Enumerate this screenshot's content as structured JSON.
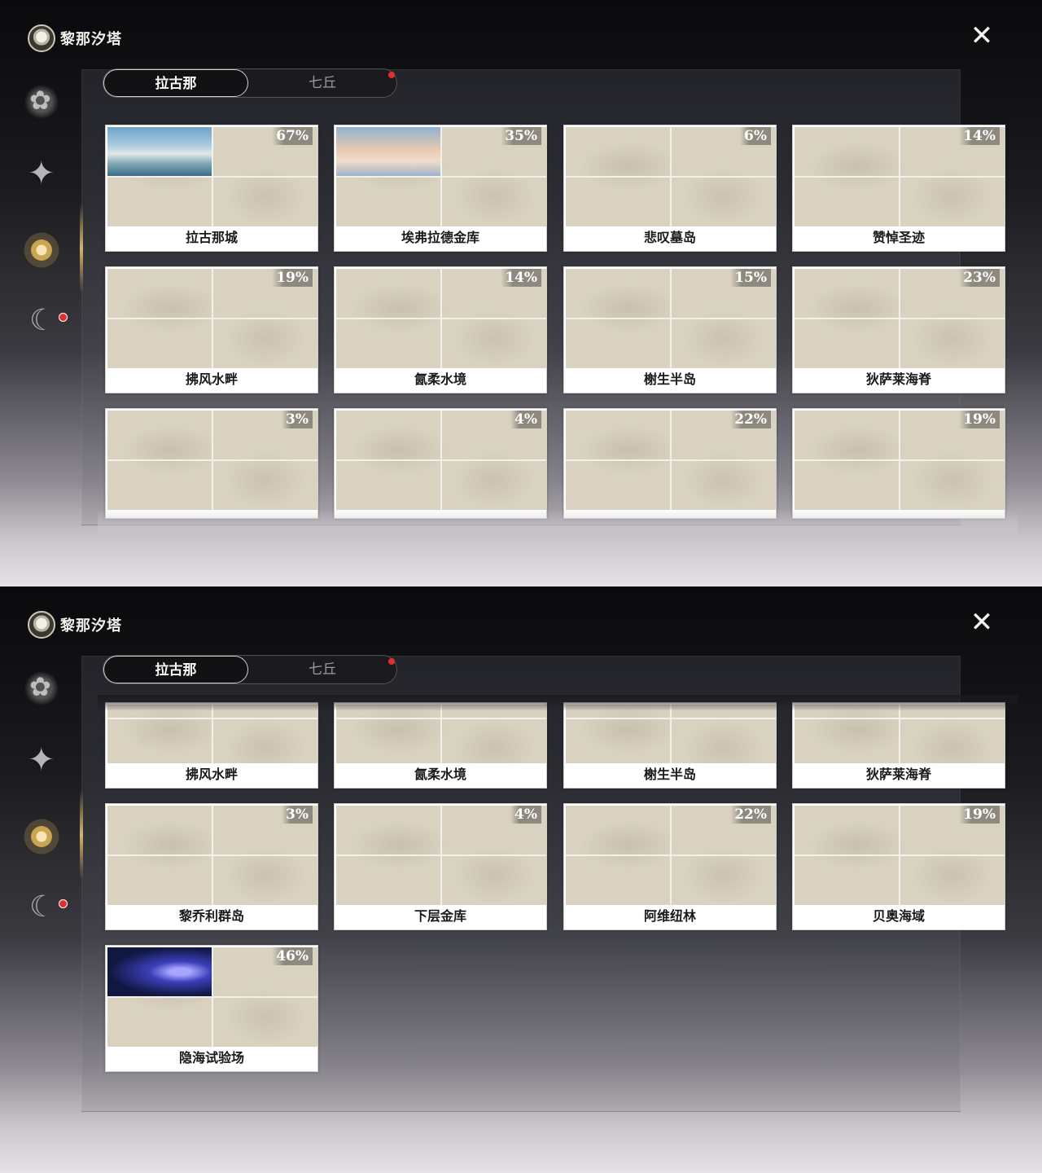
{
  "app": {
    "title": "黎那汐塔"
  },
  "tabs": {
    "active": "拉古那",
    "other": "七丘"
  },
  "icons": {
    "close": "close-x-icon"
  },
  "colors": {
    "badge": "#e0302d",
    "accent_gold": "#c9a653"
  },
  "panel1": {
    "cards": [
      {
        "name": "拉古那城",
        "pct": "67%"
      },
      {
        "name": "埃弗拉德金库",
        "pct": "35%"
      },
      {
        "name": "悲叹墓岛",
        "pct": "6%"
      },
      {
        "name": "赞悼圣迹",
        "pct": "14%"
      },
      {
        "name": "拂风水畔",
        "pct": "19%"
      },
      {
        "name": "氤柔水境",
        "pct": "14%"
      },
      {
        "name": "榭生半岛",
        "pct": "15%"
      },
      {
        "name": "狄萨莱海脊",
        "pct": "23%"
      },
      {
        "name": "",
        "pct": "3%"
      },
      {
        "name": "",
        "pct": "4%"
      },
      {
        "name": "",
        "pct": "22%"
      },
      {
        "name": "",
        "pct": "19%"
      }
    ]
  },
  "panel2": {
    "cards": [
      {
        "name": "拂风水畔",
        "pct": ""
      },
      {
        "name": "氤柔水境",
        "pct": ""
      },
      {
        "name": "榭生半岛",
        "pct": ""
      },
      {
        "name": "狄萨莱海脊",
        "pct": ""
      },
      {
        "name": "黎乔利群岛",
        "pct": "3%"
      },
      {
        "name": "下层金库",
        "pct": "4%"
      },
      {
        "name": "阿维纽林",
        "pct": "22%"
      },
      {
        "name": "贝奥海域",
        "pct": "19%"
      },
      {
        "name": "隐海试验场",
        "pct": "46%"
      }
    ]
  }
}
